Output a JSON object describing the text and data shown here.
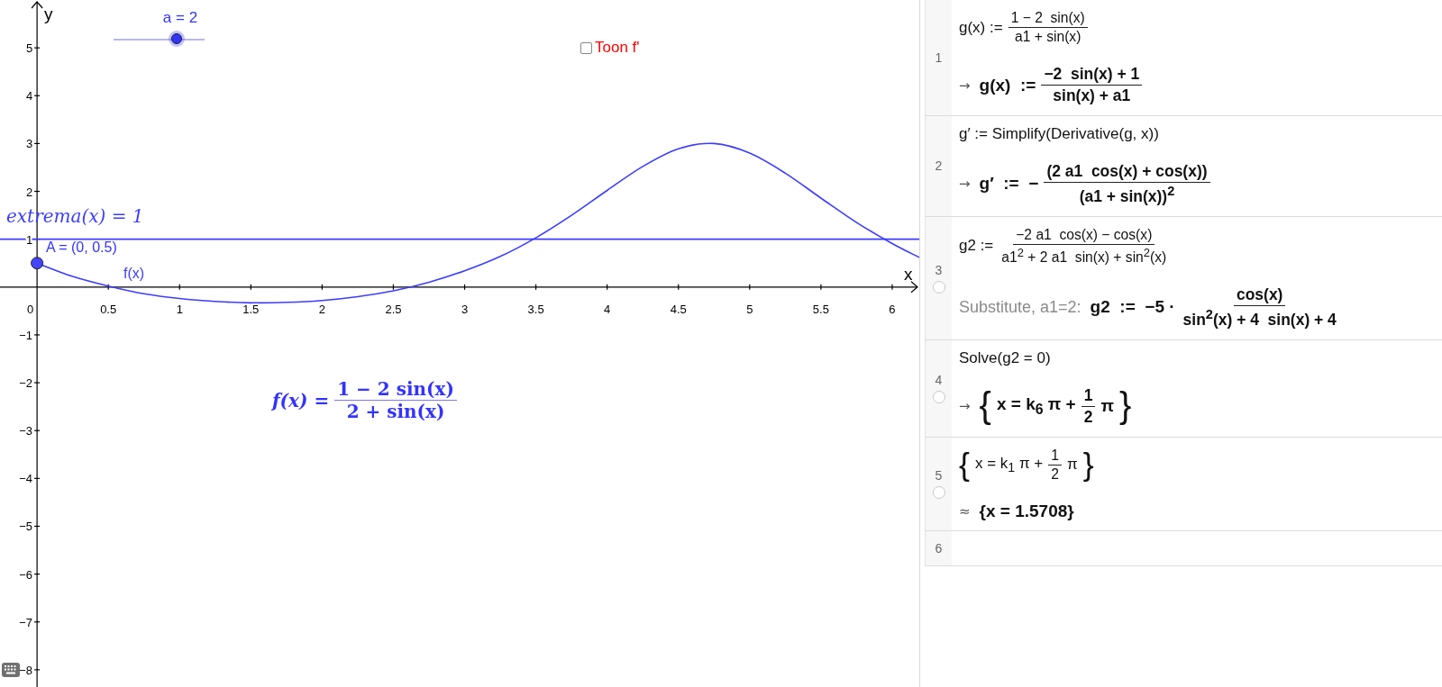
{
  "graph": {
    "axis_labels": [
      "x",
      "y"
    ],
    "chart_data": {
      "type": "line",
      "xlim": [
        -0.26,
        6.19
      ],
      "ylim": [
        -8.36,
        6.0
      ],
      "xticks": [
        {
          "value": 0,
          "label": "0"
        },
        0.5,
        1,
        1.5,
        2,
        2.5,
        3,
        3.5,
        4,
        4.5,
        5,
        5.5,
        6
      ],
      "yticks": [
        {
          "value": -8,
          "label": "−8"
        },
        {
          "value": -7,
          "label": "−7"
        },
        {
          "value": -6,
          "label": "−6"
        },
        {
          "value": -5,
          "label": "−5"
        },
        {
          "value": -4,
          "label": "−4"
        },
        {
          "value": -3,
          "label": "−3"
        },
        {
          "value": -2,
          "label": "−2"
        },
        {
          "value": -1,
          "label": "−1"
        },
        1,
        2,
        3,
        4,
        5
      ],
      "series": [
        {
          "name": "f(x)",
          "color": "#3c3cff",
          "x": [
            0,
            0.25,
            0.5,
            0.75,
            1,
            1.25,
            1.5,
            1.75,
            2,
            2.25,
            2.5,
            2.75,
            3,
            3.25,
            3.5,
            3.75,
            4,
            4.25,
            4.5,
            4.75,
            5,
            5.25,
            5.5,
            5.75,
            6,
            6.19
          ],
          "values": [
            0.5,
            0.22,
            0.02,
            -0.14,
            -0.24,
            -0.3,
            -0.33,
            -0.32,
            -0.28,
            -0.2,
            -0.08,
            0.1,
            0.34,
            0.64,
            1.03,
            1.5,
            2.02,
            2.52,
            2.89,
            3.0,
            2.8,
            2.38,
            1.86,
            1.35,
            0.91,
            0.62
          ]
        },
        {
          "name": "extrema(x) = 1",
          "color": "#3c3cff",
          "x": [
            -0.26,
            6.19
          ],
          "values": [
            1,
            1
          ]
        }
      ]
    },
    "point": {
      "label": "A = (0, 0.5)"
    },
    "slider": {
      "label": "a = 2",
      "level": 0.71
    },
    "checkbox": {
      "label": "Toon f'",
      "checked": false
    },
    "formula": {
      "lhs": "f(x) =",
      "numerator": "1 − 2 sin(x)",
      "denominator": "2 + sin(x)"
    }
  },
  "cas": {
    "rows": [
      {
        "number": "1",
        "input": [
          {
            "kind": "text",
            "text": "g(x) :="
          },
          {
            "kind": "frac",
            "num": "1 − 2  sin(x)",
            "den": "a1 + sin(x)"
          }
        ],
        "output": {
          "prefix": {
            "kind": "symbol",
            "text": "→"
          },
          "tokens": [
            {
              "kind": "text",
              "text": "g(x)  :="
            },
            {
              "kind": "frac",
              "num": "−2  sin(x) + 1",
              "den": "sin(x) + a1"
            }
          ]
        }
      },
      {
        "number": "2",
        "input": [
          {
            "kind": "text",
            "text": "g′ := Simplify(Derivative(g, x))"
          }
        ],
        "output": {
          "prefix": {
            "kind": "symbol",
            "text": "→"
          },
          "tokens": [
            {
              "kind": "text",
              "text": "g′  :=  −"
            },
            {
              "kind": "frac",
              "num": "(2 a1  cos(x) + cos(x))",
              "den": "(a1 + sin(x))$^{2}$"
            }
          ]
        }
      },
      {
        "number": "3",
        "plotted": false,
        "input": [
          {
            "kind": "text",
            "text": "g2 :="
          },
          {
            "kind": "frac",
            "num": "−2 a1  cos(x) − cos(x)",
            "den": "a1$^{2}$ + 2 a1  sin(x) + sin$^{2}$(x)"
          }
        ],
        "output": {
          "prefix": {
            "kind": "label",
            "text": "Substitute, a1=2:"
          },
          "tokens": [
            {
              "kind": "text",
              "text": "g2  :=  −5 ·"
            },
            {
              "kind": "frac",
              "num": "cos(x)",
              "den": "sin$^{2}$(x) + 4  sin(x) + 4"
            }
          ]
        }
      },
      {
        "number": "4",
        "plotted": false,
        "input": [
          {
            "kind": "text",
            "text": "Solve(g2 = 0)"
          }
        ],
        "output": {
          "prefix": {
            "kind": "symbol",
            "text": "→"
          },
          "tokens": [
            {
              "kind": "brace",
              "text": "{"
            },
            {
              "kind": "text",
              "text": "x = k$_{6}$ π +"
            },
            {
              "kind": "frac",
              "num": "1",
              "den": "2"
            },
            {
              "kind": "text",
              "text": "π"
            },
            {
              "kind": "brace",
              "text": "}"
            }
          ]
        }
      },
      {
        "number": "5",
        "plotted": false,
        "input": [
          {
            "kind": "brace",
            "text": "{"
          },
          {
            "kind": "text",
            "text": "x = k$_{1}$ π +"
          },
          {
            "kind": "frac",
            "num": "1",
            "den": "2"
          },
          {
            "kind": "text",
            "text": "π"
          },
          {
            "kind": "brace",
            "text": "}"
          }
        ],
        "output": {
          "prefix": {
            "kind": "symbol",
            "text": "≈"
          },
          "tokens": [
            {
              "kind": "text",
              "text": "{x = 1.5708}"
            }
          ]
        }
      },
      {
        "number": "6"
      }
    ]
  }
}
